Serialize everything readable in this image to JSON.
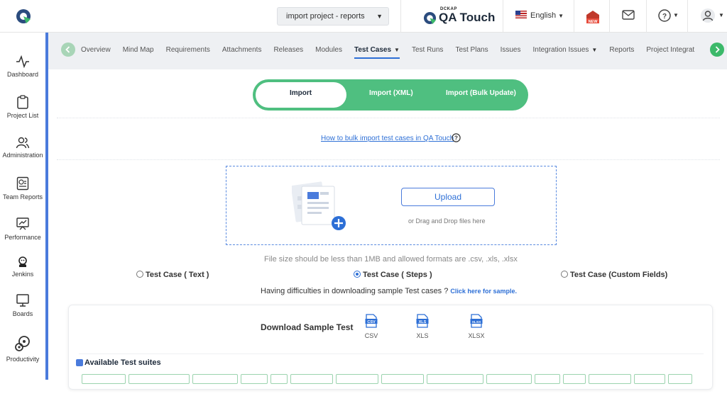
{
  "header": {
    "project_select": "import project - reports",
    "brand_small": "DCKAP",
    "brand_name": "QA Touch",
    "language": "English"
  },
  "sidebar": {
    "items": [
      {
        "label": "Dashboard",
        "icon": "activity-icon"
      },
      {
        "label": "Project List",
        "icon": "clipboard-icon"
      },
      {
        "label": "Administration",
        "icon": "users-icon"
      },
      {
        "label": "Team Reports",
        "icon": "report-icon"
      },
      {
        "label": "Performance",
        "icon": "performance-icon"
      },
      {
        "label": "Jenkins",
        "icon": "jenkins-icon"
      },
      {
        "label": "Boards",
        "icon": "board-icon"
      },
      {
        "label": "Productivity",
        "icon": "productivity-icon"
      }
    ]
  },
  "tabs": [
    {
      "label": "Overview"
    },
    {
      "label": "Mind Map"
    },
    {
      "label": "Requirements"
    },
    {
      "label": "Attachments"
    },
    {
      "label": "Releases"
    },
    {
      "label": "Modules"
    },
    {
      "label": "Test Cases",
      "active": true
    },
    {
      "label": "Test Runs"
    },
    {
      "label": "Test Plans"
    },
    {
      "label": "Issues"
    },
    {
      "label": "Integration Issues"
    },
    {
      "label": "Reports"
    },
    {
      "label": "Project Integrat"
    }
  ],
  "import_toggle": {
    "options": [
      "Import",
      "Import (XML)",
      "Import (Bulk Update)"
    ],
    "selected": "Import"
  },
  "help_link": "How to bulk import test cases in QA Touch",
  "upload": {
    "button": "Upload",
    "drag_text": "or Drag and Drop files here",
    "size_note": "File size should be less than 1MB and allowed formats are .csv, .xls, .xlsx"
  },
  "radio_options": [
    {
      "label": "Test Case ( Text )",
      "checked": false
    },
    {
      "label": "Test Case ( Steps )",
      "checked": true
    },
    {
      "label": "Test Case (Custom Fields)",
      "checked": false
    }
  ],
  "difficulty": {
    "text": "Having difficulties in downloading sample Test cases ?",
    "link": "Click here for sample."
  },
  "download": {
    "title": "Download Sample Test",
    "formats": [
      "CSV",
      "XLS",
      "XLSX"
    ]
  },
  "suites": {
    "title": "Available Test suites"
  },
  "colors": {
    "accent_green": "#4fbf80",
    "accent_blue": "#2d6fd6",
    "sidebar_border": "#4a7bdc"
  }
}
